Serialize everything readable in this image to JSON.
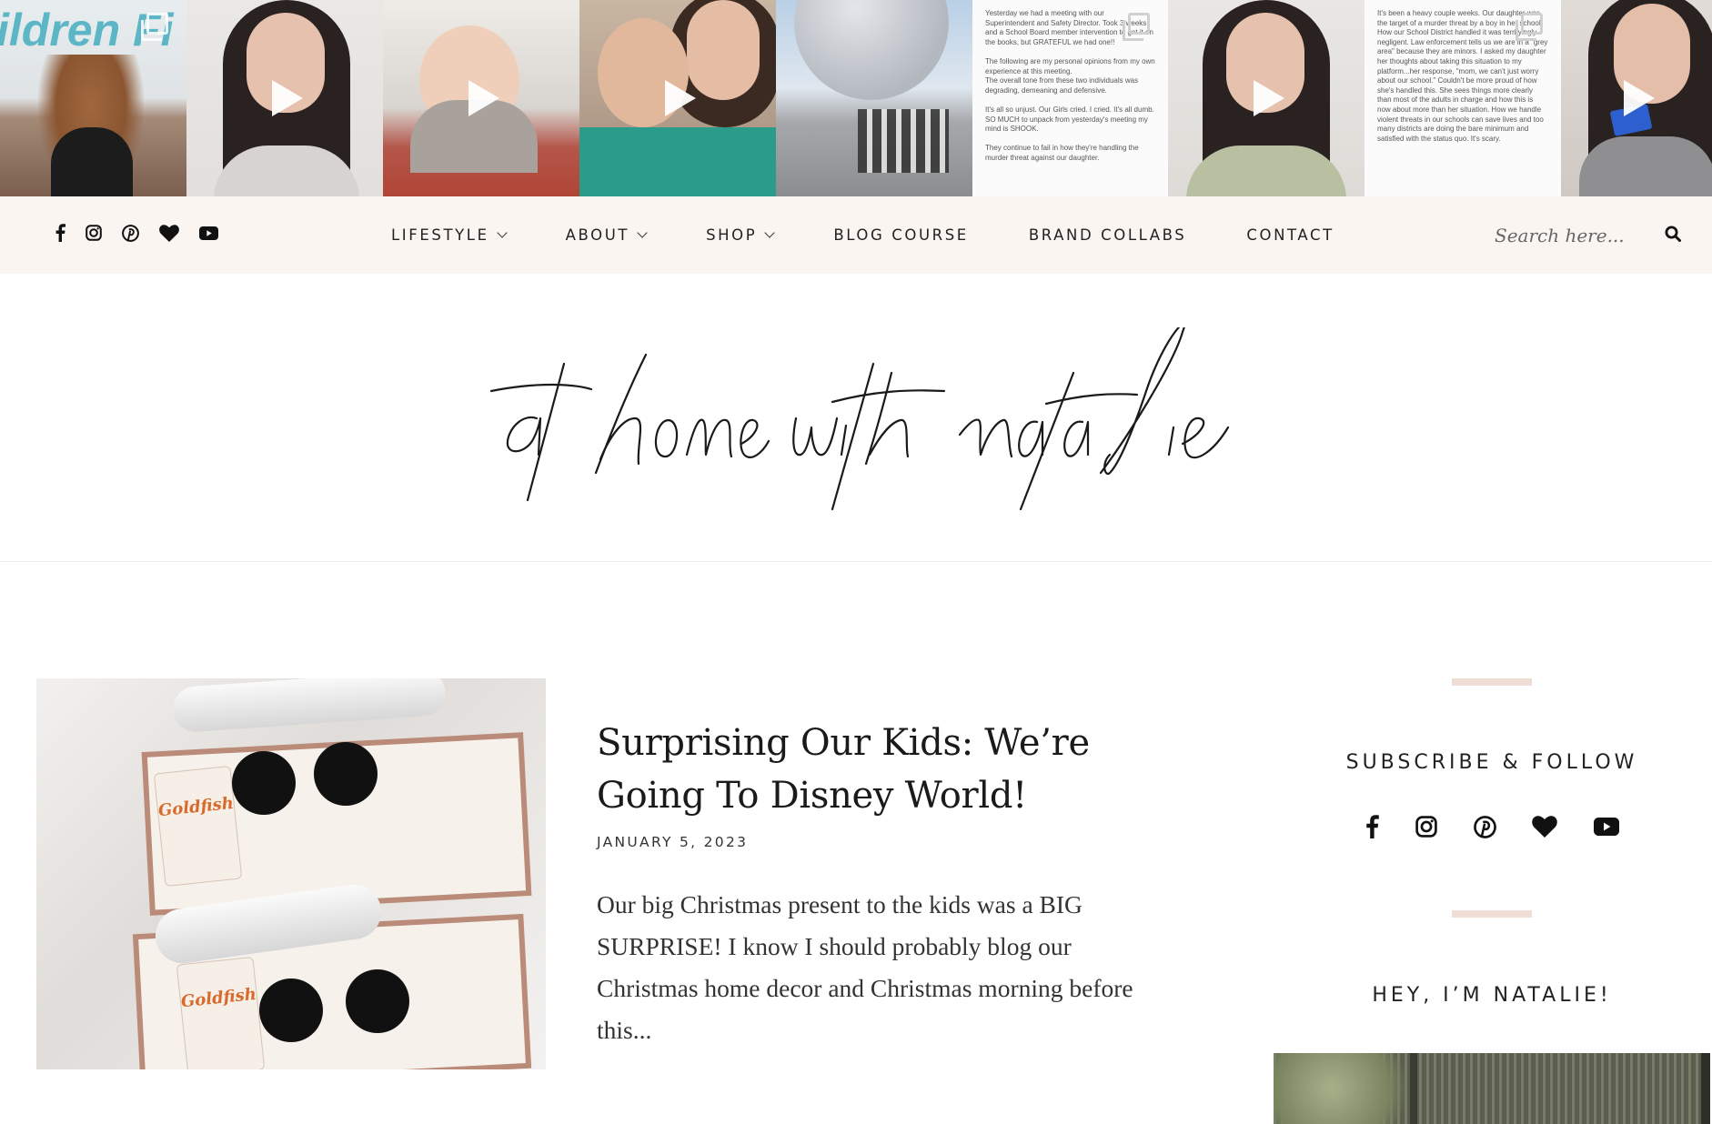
{
  "instagram": {
    "tiles": [
      {
        "kind": "image",
        "overlay": "multi",
        "caption_text": "ildren Fi"
      },
      {
        "kind": "video",
        "overlay": "play"
      },
      {
        "kind": "video",
        "overlay": "play"
      },
      {
        "kind": "video",
        "overlay": "play"
      },
      {
        "kind": "image",
        "overlay": "none"
      },
      {
        "kind": "text",
        "overlay": "multi",
        "text": "Yesterday we had a meeting with our Superintendent and Safety Director. Took 3 weeks and a School Board member intervention to get it on the books, but GRATEFUL we had one!!\n\nThe following are my personal opinions from my own experience at this meeting.\nThe overall tone from these two individuals was degrading, demeaning and defensive.\n\nIt's all so unjust. Our Girls cried. I cried. It's all dumb. SO MUCH to unpack from yesterday's meeting my mind is SHOOK.\n\nThey continue to fail in how they're handling the murder threat against our daughter."
      },
      {
        "kind": "video",
        "overlay": "play"
      },
      {
        "kind": "text",
        "overlay": "multi",
        "text": "It's been a heavy couple weeks. Our daughter was the target of a murder threat by a boy in her school. How our School District handled it was terrifyingly negligent. Law enforcement tells us we are in a \"grey area\" because they are minors. I asked my daughter her thoughts about taking this situation to my platform...her response, \"mom, we can't just worry about our school.\" Couldn't be more proud of how she's handled this. She sees things more clearly than most of the adults in charge and how this is now about more than her situation. How we handle violent threats in our schools can save lives and too many districts are doing the bare minimum and satisfied with the status quo. It's scary."
      },
      {
        "kind": "video",
        "overlay": "play"
      }
    ]
  },
  "nav": {
    "social_icons": [
      "facebook-icon",
      "instagram-icon",
      "pinterest-icon",
      "heart-icon",
      "youtube-icon"
    ],
    "menu": [
      {
        "label": "LIFESTYLE",
        "has_dropdown": true
      },
      {
        "label": "ABOUT",
        "has_dropdown": true
      },
      {
        "label": "SHOP",
        "has_dropdown": true
      },
      {
        "label": "BLOG COURSE",
        "has_dropdown": false
      },
      {
        "label": "BRAND COLLABS",
        "has_dropdown": false
      },
      {
        "label": "CONTACT",
        "has_dropdown": false
      }
    ],
    "search_placeholder": "Search here...",
    "background": "#faf5f1"
  },
  "logo": {
    "text": "at home with natalie"
  },
  "post": {
    "title": "Surprising Our Kids: We’re Going To Disney World!",
    "date": "JANUARY 5, 2023",
    "excerpt": "Our big Christmas present to the kids was a BIG SURPRISE! I know I should probably blog our Christmas home decor and Christmas morning before this...",
    "image_labels": [
      "Goldfish",
      "Goldfish"
    ]
  },
  "sidebar": {
    "subscribe_heading": "SUBSCRIBE & FOLLOW",
    "social_icons": [
      "facebook-icon",
      "instagram-icon",
      "pinterest-icon",
      "heart-icon",
      "youtube-icon"
    ],
    "about_heading": "HEY, I’M NATALIE!",
    "accent_color": "#f0ddd5"
  }
}
